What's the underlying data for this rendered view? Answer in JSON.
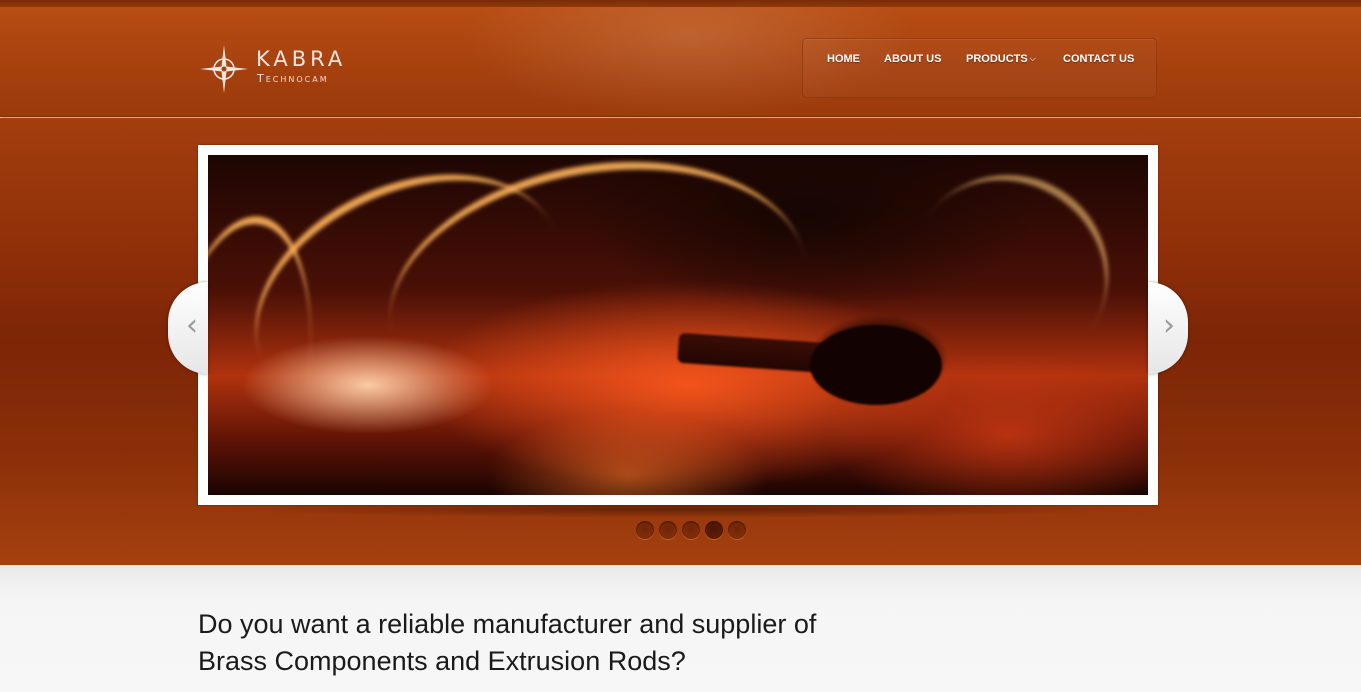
{
  "logo": {
    "title": "KABRA",
    "subtitle": "Technocam",
    "icon": "compass-star-icon"
  },
  "nav": {
    "items": [
      {
        "label": "HOME"
      },
      {
        "label": "ABOUT US"
      },
      {
        "label": "PRODUCTS",
        "has_dropdown": true
      },
      {
        "label": "CONTACT US"
      }
    ],
    "dropdown_caret": "⌵"
  },
  "slider": {
    "prev_label": "‹",
    "next_label": "›",
    "slide_count": 5,
    "active_slide": 4,
    "image_subject": "furnace-fire-image"
  },
  "content": {
    "headline_line1": "Do you want a reliable manufacturer and supplier of",
    "headline_line2": "Brass Components and Extrusion Rods?"
  },
  "colors": {
    "header": "#a8420f",
    "hero": "#7d2506",
    "content_bg": "#f5f5f5",
    "text": "#1a1a1a"
  }
}
